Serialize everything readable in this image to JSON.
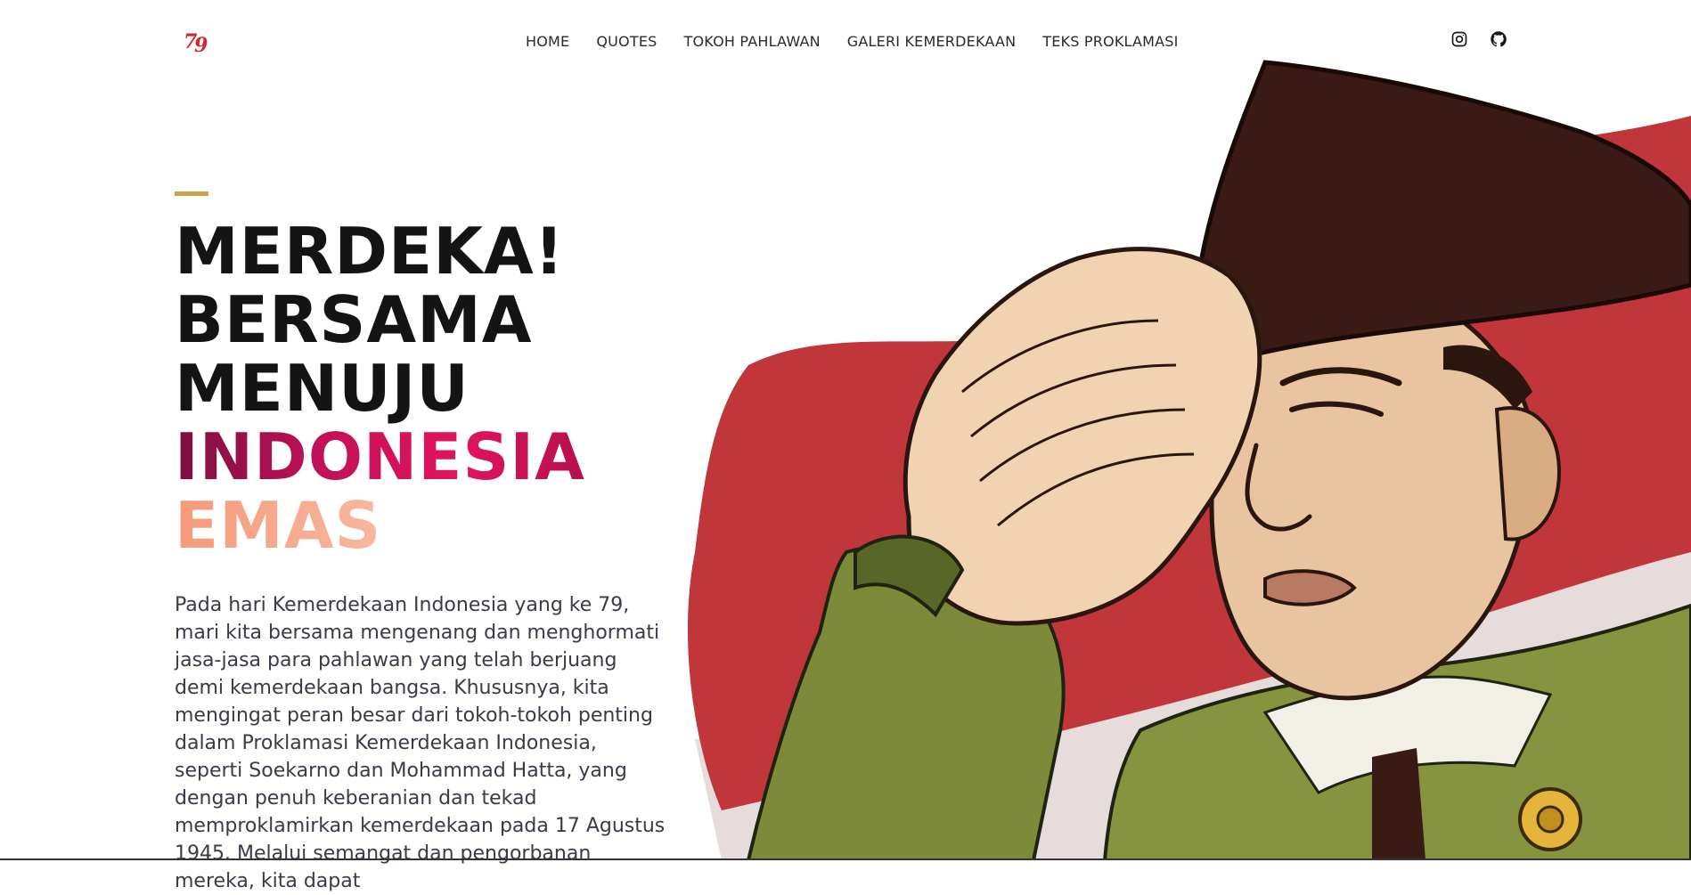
{
  "nav": {
    "logo_text": "79",
    "items": [
      {
        "label": "HOME"
      },
      {
        "label": "QUOTES"
      },
      {
        "label": "TOKOH PAHLAWAN"
      },
      {
        "label": "GALERI KEMERDEKAAN"
      },
      {
        "label": "TEKS PROKLAMASI"
      }
    ],
    "social": [
      {
        "icon": "instagram-icon"
      },
      {
        "icon": "github-icon"
      }
    ]
  },
  "hero": {
    "headline": {
      "line1": "MERDEKA!",
      "line2": "BERSAMA",
      "line3": "MENUJU",
      "line4": "INDONESIA",
      "line5": "EMAS"
    },
    "paragraph": "Pada hari Kemerdekaan Indonesia yang ke 79, mari kita bersama mengenang dan menghormati jasa-jasa para pahlawan yang telah berjuang demi kemerdekaan bangsa. Khususnya, kita mengingat peran besar dari tokoh-tokoh penting dalam Proklamasi Kemerdekaan Indonesia, seperti Soekarno dan Mohammad Hatta, yang dengan penuh keberanian dan tekad memproklamirkan kemerdekaan pada 17 Agustus 1945. Melalui semangat dan pengorbanan mereka, kita dapat"
  },
  "colors": {
    "accent_gold": "#c9a352",
    "flag_red": "#c0363a",
    "flag_white": "#e6dcdc",
    "indonesia_gradient": "#c01158",
    "emas_gradient": "#f7b89f",
    "hat": "#3a1a14",
    "skin": "#e8c4a0",
    "uniform": "#7d8a3a"
  }
}
